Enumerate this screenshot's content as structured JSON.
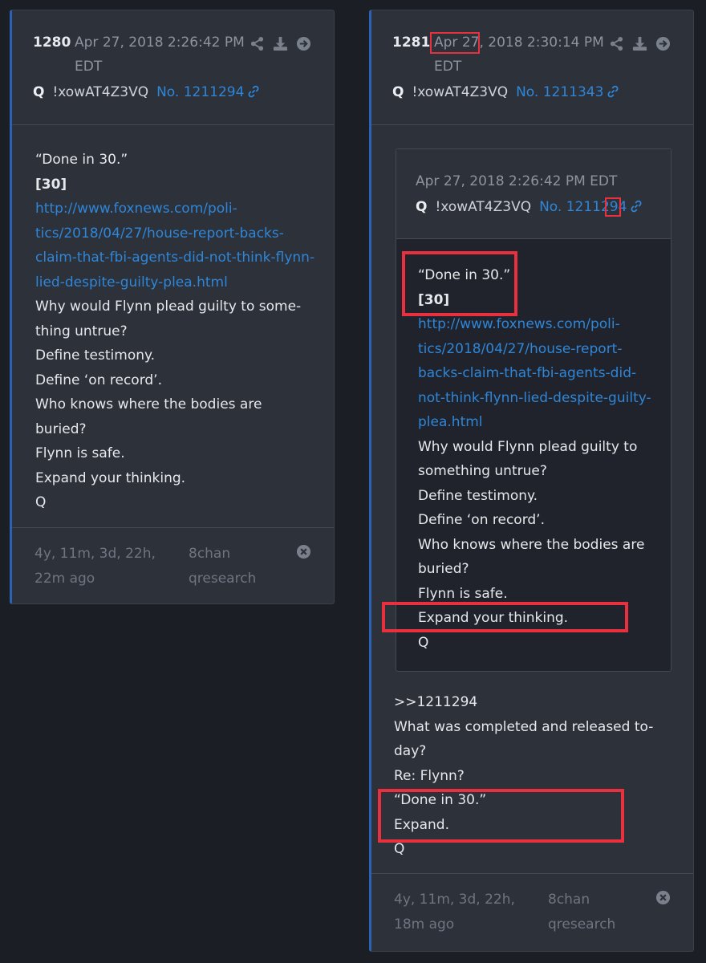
{
  "left_post": {
    "number": "1280",
    "date": "Apr 27, 2018 2:26:42 PM EDT",
    "author": "Q",
    "tripcode": "!xowAT4Z3VQ",
    "post_no": "No. 1211294",
    "body": {
      "line1": "“Done in 30.”",
      "line2": "[30]",
      "link1": "http://www.foxnews.com/poli-",
      "link2": "tics/2018/04/27/house-report-backs-",
      "link3": "claim-that-fbi-agents-did-not-think-flynn-",
      "link4": "lied-despite-guilty-plea.html",
      "t1": "Why would Flynn plead guilty to some-",
      "t2": "thing untrue?",
      "t3": "Define testimony.",
      "t4": "Define ‘on record’.",
      "t5": "Who knows where the bodies are",
      "t6": "buried?",
      "t7": "Flynn is safe.",
      "t8": "Expand your thinking.",
      "t9": "Q"
    },
    "ago": "4y, 11m, 3d, 22h, 22m ago",
    "board": "8chan qresearch"
  },
  "right_post": {
    "number": "1281",
    "date_a": "Apr 27",
    "date_b": ", 2018 2:30:14 PM EDT",
    "author": "Q",
    "tripcode": "!xowAT4Z3VQ",
    "post_no": "No. 1211343",
    "quoted": {
      "date": "Apr 27, 2018 2:26:42 PM EDT",
      "author": "Q",
      "tripcode": "!xowAT4Z3VQ",
      "post_no_a": "No. 1211",
      "post_no_b": "29",
      "post_no_c": "4",
      "body": {
        "line1": "“Done in 30.”",
        "line2": "[30]",
        "link1": "http://www.foxnews.com/poli-",
        "link2": "tics/2018/04/27/house-report-",
        "link3": "backs-claim-that-fbi-agents-did-",
        "link4": "not-think-flynn-lied-despite-guilty-",
        "link5": "plea.html",
        "t1": "Why would Flynn plead guilty to",
        "t2": "something untrue?",
        "t3": "Define testimony.",
        "t4": "Define ‘on record’.",
        "t5": "Who knows where the bodies are",
        "t6": "buried?",
        "t7": "Flynn is safe.",
        "t8": "Expand your thinking.",
        "t9": "Q"
      }
    },
    "reply": {
      "r1": ">>1211294",
      "r2": "What was completed and released to-",
      "r3": "day?",
      "r4": "Re: Flynn?",
      "r5": "“Done in 30.”",
      "r6": "Expand.",
      "r7": "Q"
    },
    "ago": "4y, 11m, 3d, 22h, 18m ago",
    "board": "8chan qresearch"
  },
  "colors": {
    "background": "#1b1e25",
    "card": "#2d313a",
    "accent_border": "#2c62b3",
    "link": "#2f86d8",
    "highlight": "#e8303f"
  },
  "icons": [
    "share-icon",
    "download-icon",
    "arrow-right-circle-icon",
    "link-icon",
    "close-circle-icon"
  ]
}
